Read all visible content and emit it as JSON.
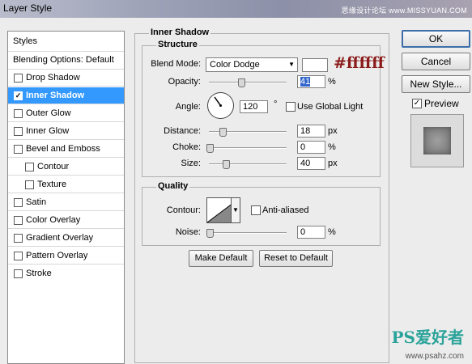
{
  "window": {
    "title": "Layer Style",
    "watermark": "思缘设计论坛 www.MISSYUAN.COM"
  },
  "sidebar": {
    "header": "Styles",
    "blending_options": "Blending Options: Default",
    "items": [
      {
        "label": "Drop Shadow",
        "checked": false,
        "selected": false
      },
      {
        "label": "Inner Shadow",
        "checked": true,
        "selected": true
      },
      {
        "label": "Outer Glow",
        "checked": false,
        "selected": false
      },
      {
        "label": "Inner Glow",
        "checked": false,
        "selected": false
      },
      {
        "label": "Bevel and Emboss",
        "checked": false,
        "selected": false
      },
      {
        "label": "Contour",
        "checked": false,
        "selected": false
      },
      {
        "label": "Texture",
        "checked": false,
        "selected": false
      },
      {
        "label": "Satin",
        "checked": false,
        "selected": false
      },
      {
        "label": "Color Overlay",
        "checked": false,
        "selected": false
      },
      {
        "label": "Gradient Overlay",
        "checked": false,
        "selected": false
      },
      {
        "label": "Pattern Overlay",
        "checked": false,
        "selected": false
      },
      {
        "label": "Stroke",
        "checked": false,
        "selected": false
      }
    ]
  },
  "inner_shadow": {
    "section_title": "Inner Shadow",
    "structure": {
      "title": "Structure",
      "blend_mode_label": "Blend Mode:",
      "blend_mode_value": "Color Dodge",
      "color_annotation": "#ffffff",
      "opacity_label": "Opacity:",
      "opacity_value": "41",
      "opacity_unit": "%",
      "angle_label": "Angle:",
      "angle_value": "120",
      "angle_unit": "°",
      "global_light_label": "Use Global Light",
      "distance_label": "Distance:",
      "distance_value": "18",
      "distance_unit": "px",
      "choke_label": "Choke:",
      "choke_value": "0",
      "choke_unit": "%",
      "size_label": "Size:",
      "size_value": "40",
      "size_unit": "px"
    },
    "quality": {
      "title": "Quality",
      "contour_label": "Contour:",
      "anti_aliased_label": "Anti-aliased",
      "noise_label": "Noise:",
      "noise_value": "0",
      "noise_unit": "%"
    },
    "make_default": "Make Default",
    "reset_default": "Reset to Default"
  },
  "buttons": {
    "ok": "OK",
    "cancel": "Cancel",
    "new_style": "New Style...",
    "preview_label": "Preview"
  },
  "branding": {
    "logo_text": "PS爱好者",
    "logo_url": "www.psahz.com"
  },
  "colors": {
    "selection": "#3399ff",
    "annotation": "#8b1a1a",
    "logo": "#2aa39a"
  }
}
